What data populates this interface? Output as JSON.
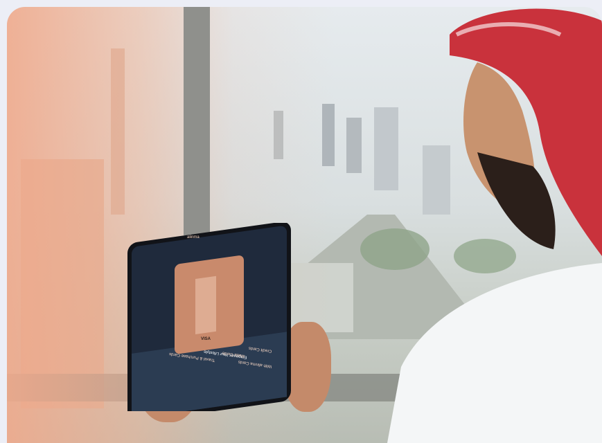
{
  "tablet": {
    "brand": "alinma",
    "card_brand": "VISA",
    "headline": "Empower Your Lifestyle",
    "subheadline": "With alinma Cards",
    "tabs": [
      "Credit Cards",
      "Mada Cards",
      "Travel & Purchase Cards"
    ]
  },
  "colors": {
    "accent": "#e8a07a",
    "tablet_screen": "#1f2a3c",
    "card": "#c98a6c"
  }
}
